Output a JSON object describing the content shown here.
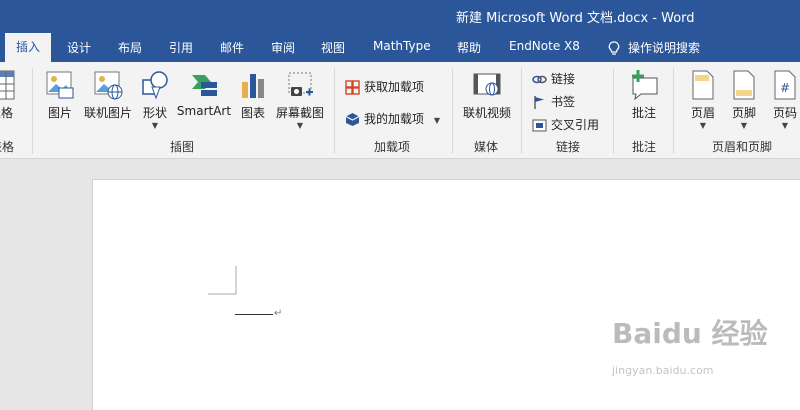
{
  "window": {
    "title": "新建 Microsoft Word 文档.docx  -  Word"
  },
  "tabs": {
    "active": "插入",
    "items": [
      "设计",
      "布局",
      "引用",
      "邮件",
      "审阅",
      "视图",
      "MathType",
      "帮助",
      "EndNote X8",
      "操作说明搜索"
    ]
  },
  "ribbon": {
    "table": {
      "label": "表格",
      "group": "表格"
    },
    "illustrations": {
      "picture": "图片",
      "online_picture": "联机图片",
      "shapes": "形状",
      "smartart": "SmartArt",
      "chart": "图表",
      "screenshot": "屏幕截图",
      "group": "插图"
    },
    "addins": {
      "get": "获取加载项",
      "mine": "我的加载项",
      "group": "加载项"
    },
    "media": {
      "online_video": "联机视频",
      "group": "媒体"
    },
    "links": {
      "link": "链接",
      "bookmark": "书签",
      "crossref": "交叉引用",
      "group": "链接"
    },
    "comments": {
      "comment": "批注",
      "group": "批注"
    },
    "header_footer": {
      "header": "页眉",
      "footer": "页脚",
      "page_number": "页码",
      "group": "页眉和页脚"
    }
  },
  "colors": {
    "accent": "#2b579a",
    "ribbon_bg": "#f3f3f3",
    "doc_bg": "#e6e6e6"
  },
  "watermark": {
    "brand": "Baidu 经验",
    "url": "jingyan.baidu.com"
  }
}
